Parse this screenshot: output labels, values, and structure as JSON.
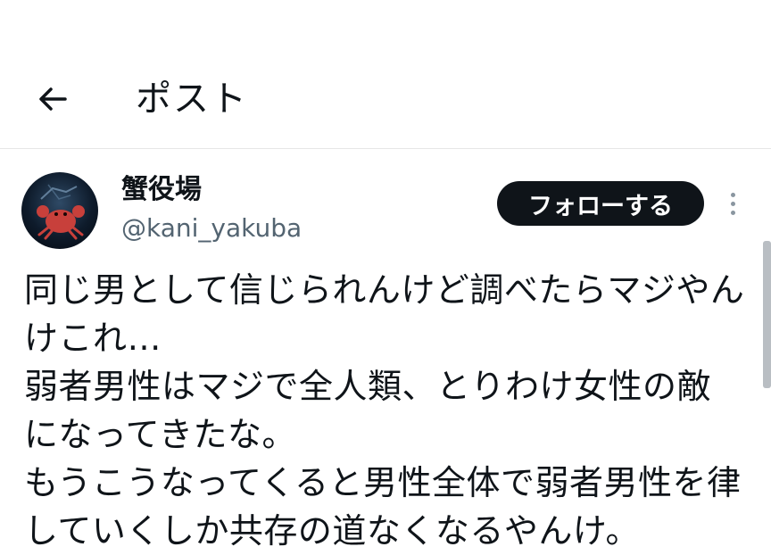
{
  "header": {
    "title": "ポスト",
    "back_icon": "arrow-left-icon"
  },
  "post": {
    "author": {
      "display_name": "蟹役場",
      "handle": "@kani_yakuba",
      "avatar_icon": "crab-avatar"
    },
    "follow_label": "フォローする",
    "more_icon": "more-vertical-icon",
    "text": "同じ男として信じられんけど調べたらマジやんけこれ…\n弱者男性はマジで全人類、とりわけ女性の敵になってきたな。\nもうこうなってくると男性全体で弱者男性を律していくしか共存の道なくなるやんけ。"
  },
  "colors": {
    "text": "#0f1419",
    "secondary_text": "#536471",
    "follow_bg": "#0f1419",
    "follow_text": "#ffffff",
    "divider": "#e6e6e6"
  }
}
